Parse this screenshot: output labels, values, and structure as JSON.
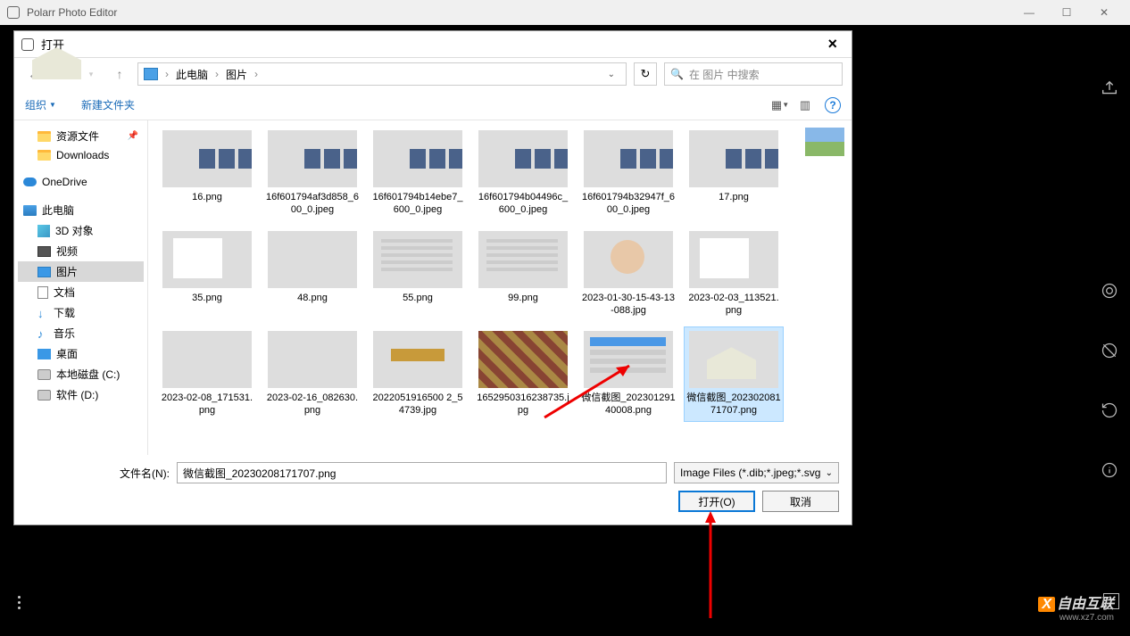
{
  "app": {
    "title": "Polarr Photo Editor"
  },
  "dialog": {
    "title": "打开",
    "breadcrumb": {
      "loc1": "此电脑",
      "loc2": "图片"
    },
    "search_placeholder": "在 图片 中搜索",
    "organize": "组织",
    "new_folder": "新建文件夹",
    "filename_label": "文件名(N):",
    "filename_value": "微信截图_20230208171707.png",
    "filetype": "Image Files (*.dib;*.jpeg;*.svg",
    "open_btn": "打开(O)",
    "cancel_btn": "取消"
  },
  "tree": {
    "resources": "资源文件",
    "downloads_en": "Downloads",
    "onedrive": "OneDrive",
    "thispc": "此电脑",
    "obj3d": "3D 对象",
    "videos": "视频",
    "pictures": "图片",
    "documents": "文档",
    "downloads": "下载",
    "music": "音乐",
    "desktop": "桌面",
    "diskc": "本地磁盘 (C:)",
    "diskd": "软件 (D:)"
  },
  "files": {
    "r1": [
      "16.png",
      "16f601794af3d858_600_0.jpeg",
      "16f601794b14ebe7_600_0.jpeg",
      "16f601794b04496c_600_0.jpeg",
      "16f601794b32947f_600_0.jpeg",
      "17.png"
    ],
    "r2": [
      "35.png",
      "48.png",
      "55.png",
      "99.png",
      "2023-01-30-15-43-13-088.jpg",
      "2023-02-03_113521.png"
    ],
    "r3": [
      "2023-02-08_171531.png",
      "2023-02-16_082630.png",
      "2022051916500 2_54739.jpg",
      "1652950316238735.jpg",
      "微信截图_20230129140008.png",
      "微信截图_20230208171707.png"
    ]
  },
  "watermark": {
    "text": "自由互联",
    "url": "www.xz7.com"
  }
}
